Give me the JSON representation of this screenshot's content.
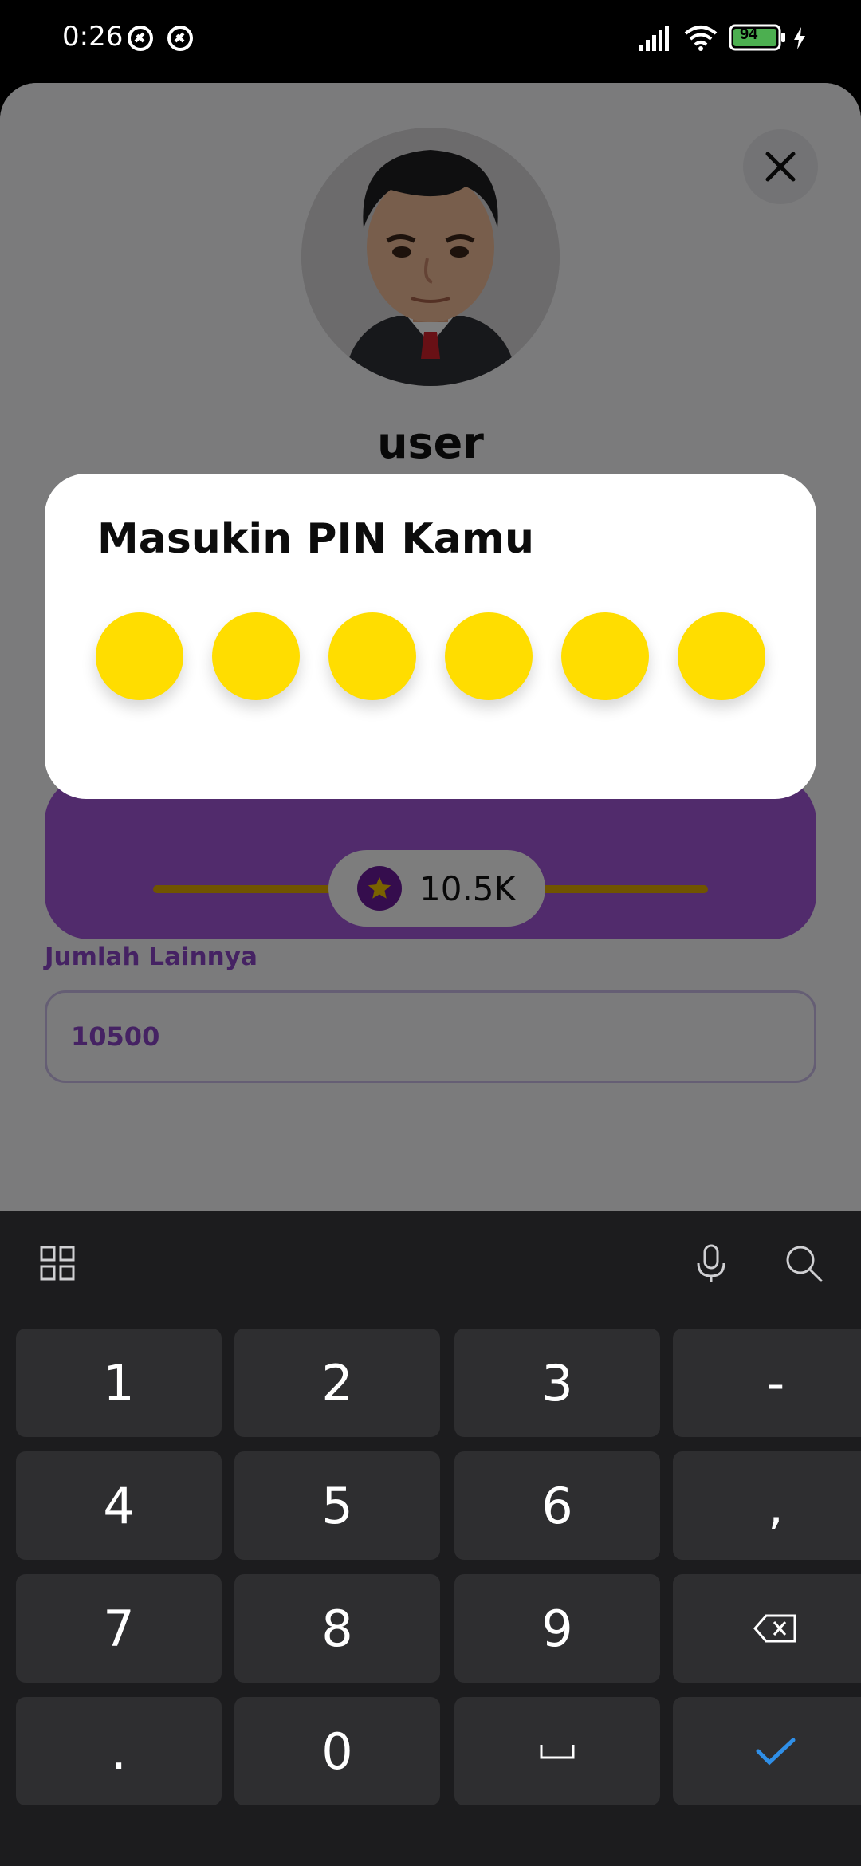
{
  "status_bar": {
    "time": "0:26",
    "battery": "94",
    "icons": [
      "notification-icon",
      "notification-icon",
      "signal-icon",
      "wifi-icon",
      "battery-icon",
      "charging-icon"
    ]
  },
  "profile": {
    "username": "user"
  },
  "amount": {
    "slider_value": "10.5K",
    "other_label": "Jumlah Lainnya",
    "other_value": "10500"
  },
  "pin_dialog": {
    "title": "Masukin PIN Kamu",
    "dots": 6
  },
  "keyboard": {
    "rows": [
      [
        "1",
        "2",
        "3",
        "-"
      ],
      [
        "4",
        "5",
        "6",
        ","
      ],
      [
        "7",
        "8",
        "9",
        "backspace"
      ],
      [
        ".",
        "0",
        "space",
        "enter"
      ]
    ]
  },
  "colors": {
    "accent_purple": "#a257d8",
    "pin_yellow": "#ffdd00",
    "keyboard_bg": "#1c1c1e",
    "key_bg": "#2e2e30",
    "enter_blue": "#2f8fe8"
  }
}
